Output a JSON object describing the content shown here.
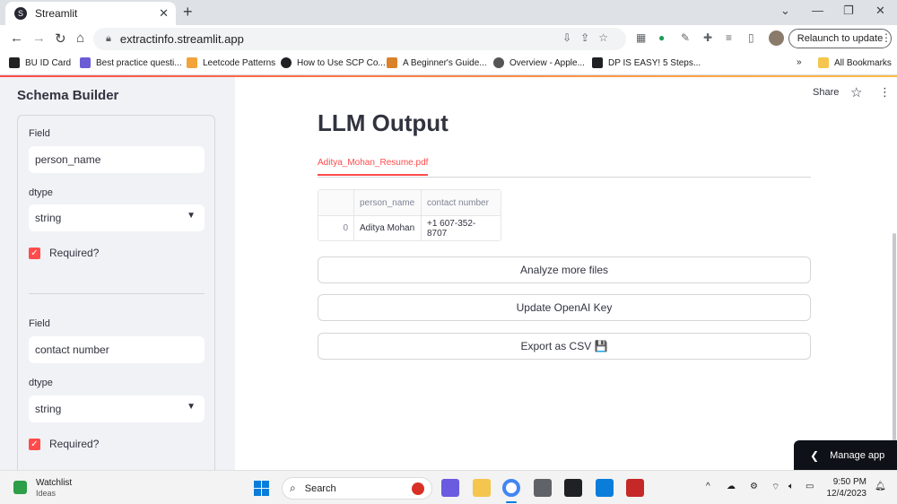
{
  "browser": {
    "tab_title": "Streamlit",
    "favicon_letter": "S",
    "url": "extractinfo.streamlit.app",
    "relaunch_label": "Relaunch to update",
    "bookmarks": [
      {
        "label": "BU ID Card",
        "color": "#222222"
      },
      {
        "label": "Best practice questi...",
        "color": "#6b5cd6"
      },
      {
        "label": "Leetcode Patterns",
        "color": "#f2a33a"
      },
      {
        "label": "How to Use SCP Co...",
        "color": "#202124"
      },
      {
        "label": "A Beginner's Guide...",
        "color": "#d9822b"
      },
      {
        "label": "Overview - Apple...",
        "color": "#555555"
      },
      {
        "label": "DP IS EASY! 5 Steps...",
        "color": "#202124"
      }
    ],
    "all_bookmarks_label": "All Bookmarks",
    "overflow_label": "»"
  },
  "sidebar": {
    "title": "Schema Builder",
    "fields": [
      {
        "field_label": "Field",
        "field_value": "person_name",
        "dtype_label": "dtype",
        "dtype_value": "string",
        "required_label": "Required?"
      },
      {
        "field_label": "Field",
        "field_value": "contact number",
        "dtype_label": "dtype",
        "dtype_value": "string",
        "required_label": "Required?"
      }
    ]
  },
  "main": {
    "share_label": "Share",
    "title": "LLM Output",
    "tabs": [
      {
        "label": "Aditya_Mohan_Resume.pdf"
      }
    ],
    "table": {
      "columns": [
        "",
        "person_name",
        "contact number"
      ],
      "rows": [
        [
          "0",
          "Aditya Mohan",
          "+1 607-352-8707"
        ]
      ]
    },
    "buttons": {
      "analyze": "Analyze more files",
      "update_key": "Update OpenAI Key",
      "export": "Export as CSV 💾"
    },
    "manage_app": "Manage app"
  },
  "taskbar": {
    "widget_title": "Watchlist",
    "widget_subtitle": "Ideas",
    "search_placeholder": "Search",
    "time": "9:50 PM",
    "date": "12/4/2023"
  },
  "colors": {
    "accent": "#ff4b4b",
    "sidebar_bg": "#f0f2f6",
    "text": "#31333f"
  }
}
